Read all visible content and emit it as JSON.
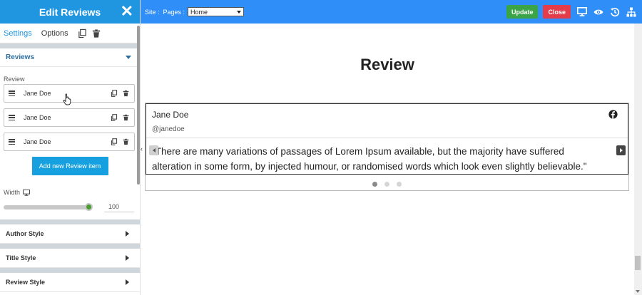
{
  "panel": {
    "title": "Edit Reviews",
    "close_glyph": "✕",
    "tabs": [
      {
        "label": "Settings",
        "active": true
      },
      {
        "label": "Options",
        "active": false
      }
    ],
    "reviews_section": {
      "title": "Reviews",
      "field_label": "Review",
      "items": [
        {
          "name": "Jane Doe"
        },
        {
          "name": "Jane Doe"
        },
        {
          "name": "Jane Doe"
        }
      ],
      "add_button": "Add new Review item"
    },
    "width": {
      "label": "Width",
      "value": "100",
      "slider_fraction": 1.0
    },
    "collapsed_sections": [
      "Author Style",
      "Title Style",
      "Review Style"
    ]
  },
  "topbar": {
    "site_label": "Site :",
    "pages_label": "Pages :",
    "page_selected": "Home",
    "update_label": "Update",
    "close_label": "Close",
    "icons": [
      "desktop-icon",
      "eye-icon",
      "history-icon",
      "sitemap-icon"
    ]
  },
  "preview": {
    "heading": "Review",
    "collapse_glyph": "‹",
    "card": {
      "author": "Jane Doe",
      "handle": "@janedoe",
      "text": "\"There are many variations of passages of Lorem Ipsum available, but the majority have suffered alteration in some form, by injected humour, or randomised words which look even slightly believable.\""
    },
    "dots": 3,
    "active_dot": 0
  },
  "colors": {
    "panel_header": "#2196e0",
    "topbar": "#2f8ef7",
    "update": "#3aa447",
    "close": "#e53c4a",
    "add_button": "#16a0e0"
  }
}
